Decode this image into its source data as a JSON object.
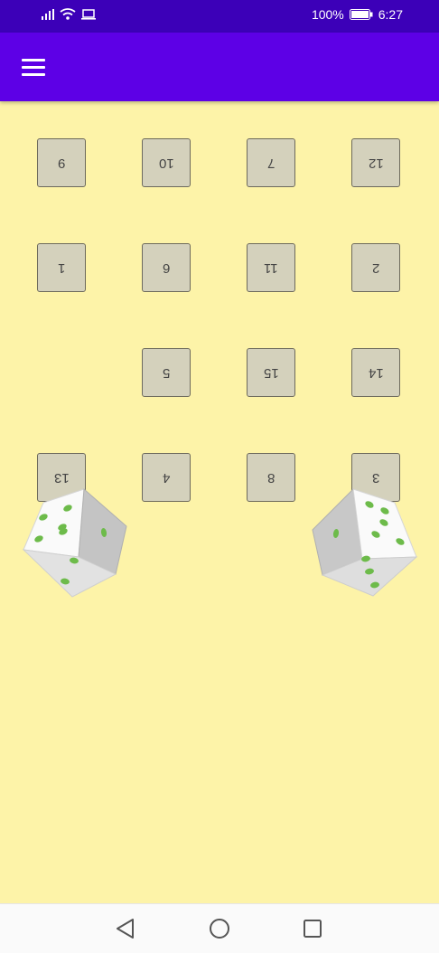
{
  "status": {
    "battery_text": "100%",
    "time": "6:27",
    "icons": [
      "signal-icon",
      "wifi-icon",
      "laptop-icon",
      "battery-icon"
    ]
  },
  "toolbar": {
    "menu_icon": "hamburger-menu-icon",
    "color": "#5d00e6"
  },
  "board": {
    "background": "#fdf3a8",
    "tiles_rotated_upside_down": true,
    "rows": [
      [
        "9",
        "10",
        "7",
        "12"
      ],
      [
        "1",
        "6",
        "11",
        "2"
      ],
      [
        "",
        "5",
        "15",
        "14"
      ],
      [
        "13",
        "4",
        "8",
        "3"
      ]
    ]
  },
  "dice": [
    {
      "name": "left-die",
      "pip_color": "#6dbb4a"
    },
    {
      "name": "right-die",
      "pip_color": "#6dbb4a"
    }
  ],
  "navbar": {
    "icons": [
      "back-icon",
      "home-icon",
      "recents-icon"
    ]
  }
}
